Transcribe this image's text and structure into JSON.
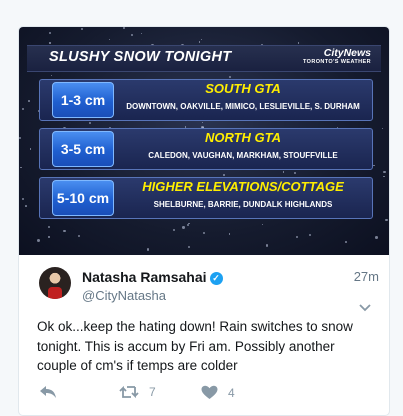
{
  "graphic": {
    "title": "SLUSHY SNOW TONIGHT",
    "logo_main": "CityNews",
    "logo_sub": "TORONTO'S WEATHER",
    "rows": [
      {
        "amount": "1-3 cm",
        "region": "SOUTH GTA",
        "areas": "DOWNTOWN, OAKVILLE, MIMICO, LESLIEVILLE, S. DURHAM"
      },
      {
        "amount": "3-5 cm",
        "region": "NORTH GTA",
        "areas": "CALEDON, VAUGHAN, MARKHAM, STOUFFVILLE"
      },
      {
        "amount": "5-10 cm",
        "region": "HIGHER ELEVATIONS/COTTAGE",
        "areas": "SHELBURNE, BARRIE, DUNDALK HIGHLANDS"
      }
    ]
  },
  "tweet": {
    "display_name": "Natasha Ramsahai",
    "verified_glyph": "✓",
    "handle": "@CityNatasha",
    "time": "27m",
    "text": "Ok ok...keep the hating down! Rain switches to snow tonight. This is accum by Fri am. Possibly another couple of cm's if temps are colder",
    "retweet_count": "7",
    "like_count": "4"
  },
  "icons": {
    "reply": "reply-icon",
    "retweet": "retweet-icon",
    "like": "heart-icon",
    "more": "chevron-down-icon",
    "verified": "verified-badge-icon"
  },
  "colors": {
    "accent": "#1da1f2",
    "region_text": "#ffee00",
    "amount_badge": "#1f5fd0"
  }
}
